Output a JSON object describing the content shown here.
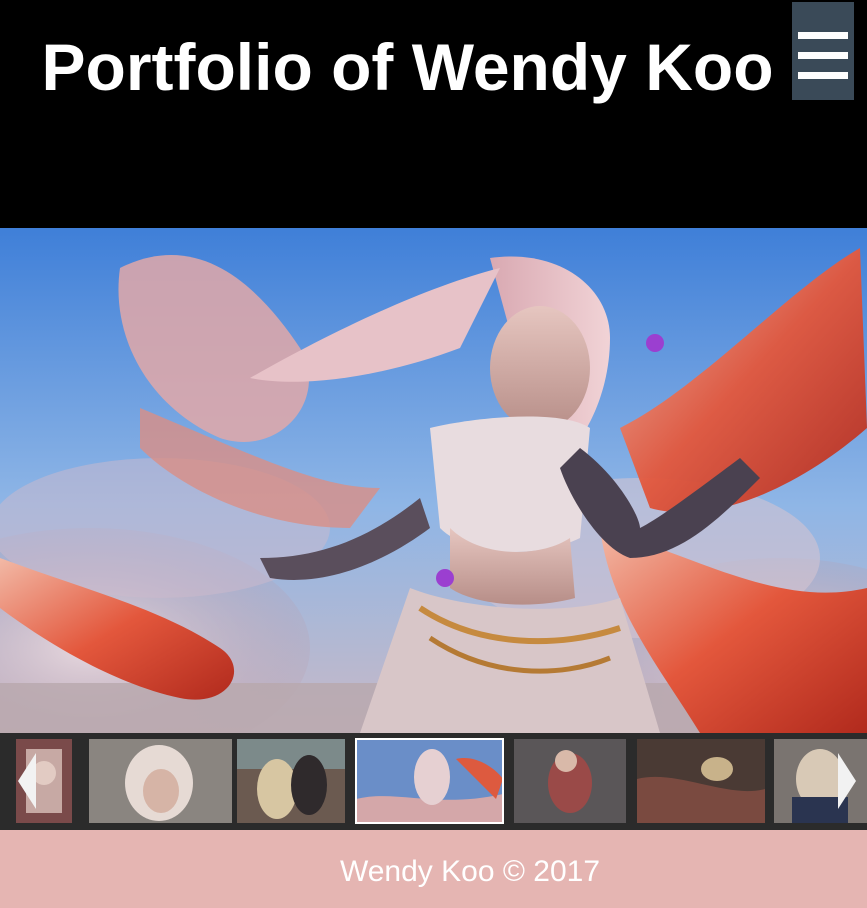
{
  "header": {
    "title": "Portfolio of Wendy Koo",
    "menu_icon": "hamburger-icon"
  },
  "hero": {
    "alt": "pink-haired dancer with red flowing scarves"
  },
  "thumbnails": {
    "prev_icon": "chevron-left-icon",
    "next_icon": "chevron-right-icon",
    "items": [
      {
        "name": "thumb-1",
        "dominant": "#7a4a4a"
      },
      {
        "name": "thumb-2",
        "dominant": "#8a8580"
      },
      {
        "name": "thumb-3",
        "dominant": "#6b5a50"
      },
      {
        "name": "thumb-4",
        "dominant": "#6a8ec8",
        "active": true
      },
      {
        "name": "thumb-5",
        "dominant": "#5a5658"
      },
      {
        "name": "thumb-6",
        "dominant": "#4a3a34"
      },
      {
        "name": "thumb-7",
        "dominant": "#7a7470"
      }
    ]
  },
  "footer": {
    "copyright": "Wendy Koo © 2017",
    "background": "#e5b5b2"
  },
  "colors": {
    "header_bg": "#000000",
    "menu_bg": "#3a4a58",
    "strip_bg": "#2b2b2b"
  }
}
